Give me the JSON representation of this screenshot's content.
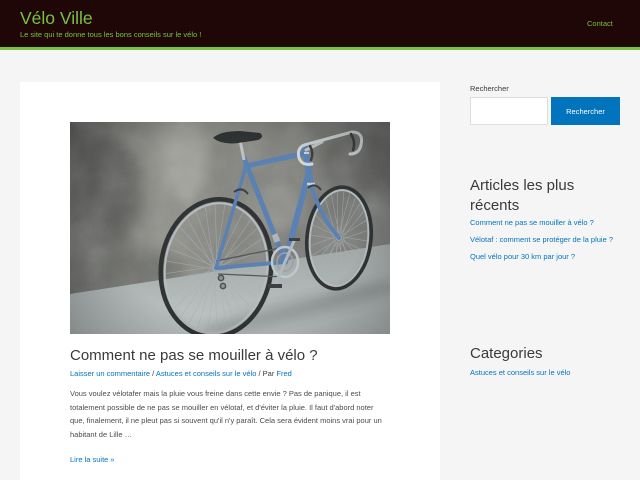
{
  "colors": {
    "header_bg": "#1f0707",
    "accent_green": "#7ac142",
    "link": "#0274be",
    "text": "#3a3a3a",
    "page_bg": "#f5f5f5",
    "card_bg": "#ffffff",
    "button_text": "#ffffff"
  },
  "header": {
    "site_title": "Vélo Ville",
    "tagline": "Le site qui te donne tous les bons conseils sur le vélo !",
    "nav": {
      "contact": "Contact"
    }
  },
  "post": {
    "title": "Comment ne pas se mouiller à vélo ?",
    "meta": {
      "comments_link": "Laisser un commentaire",
      "separator": "/",
      "category": "Astuces et conseils sur le vélo",
      "author_prefix": "Par",
      "author": "Fred"
    },
    "excerpt": "Vous voulez vélotafer mais la pluie vous freine dans cette envie ? Pas de panique, il est totalement possible de ne pas se mouiller en vélotaf, et d'éviter la pluie. Il faut d'abord noter que, finalement, il ne pleut pas si souvent qu'il n'y paraît. Cela sera évident moins vrai pour un habitant de Lille …",
    "read_more": "Lire la suite »"
  },
  "sidebar": {
    "search": {
      "label": "Rechercher",
      "button": "Rechercher"
    },
    "recent_posts": {
      "heading": "Articles les plus récents",
      "items": [
        "Comment ne pas se mouiller à vélo ?",
        "Vélotaf : comment se protéger de la pluie ?",
        "Quel vélo pour 30 km par jour ?"
      ]
    },
    "categories": {
      "heading": "Categories",
      "items": [
        "Astuces et conseils sur le vélo"
      ]
    }
  }
}
